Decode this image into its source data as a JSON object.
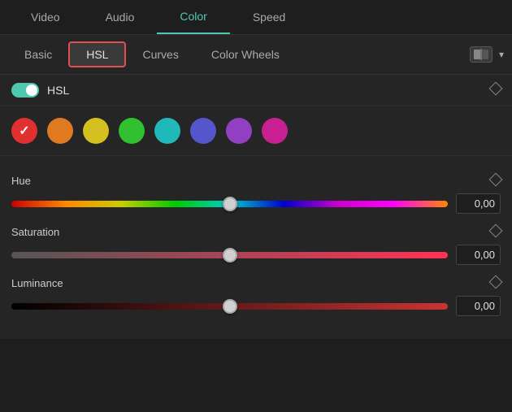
{
  "topTabs": {
    "items": [
      {
        "label": "Video",
        "active": false
      },
      {
        "label": "Audio",
        "active": false
      },
      {
        "label": "Color",
        "active": true
      },
      {
        "label": "Speed",
        "active": false
      }
    ]
  },
  "subTabs": {
    "items": [
      {
        "label": "Basic",
        "active": false
      },
      {
        "label": "HSL",
        "active": true
      },
      {
        "label": "Curves",
        "active": false
      },
      {
        "label": "Color Wheels",
        "active": false
      }
    ]
  },
  "section": {
    "toggle_label": "HSL",
    "hsl_enabled": true
  },
  "swatches": [
    {
      "color": "#e03030",
      "selected": true,
      "name": "red"
    },
    {
      "color": "#e07a20",
      "selected": false,
      "name": "orange"
    },
    {
      "color": "#d4c020",
      "selected": false,
      "name": "yellow"
    },
    {
      "color": "#30c030",
      "selected": false,
      "name": "green"
    },
    {
      "color": "#20b8b8",
      "selected": false,
      "name": "cyan"
    },
    {
      "color": "#6060d0",
      "selected": false,
      "name": "blue"
    },
    {
      "color": "#9040c0",
      "selected": false,
      "name": "purple"
    },
    {
      "color": "#c82090",
      "selected": false,
      "name": "magenta"
    }
  ],
  "sliders": {
    "hue": {
      "label": "Hue",
      "value": "0,00",
      "percent": 50
    },
    "saturation": {
      "label": "Saturation",
      "value": "0,00",
      "percent": 50
    },
    "luminance": {
      "label": "Luminance",
      "value": "0,00",
      "percent": 50
    }
  }
}
